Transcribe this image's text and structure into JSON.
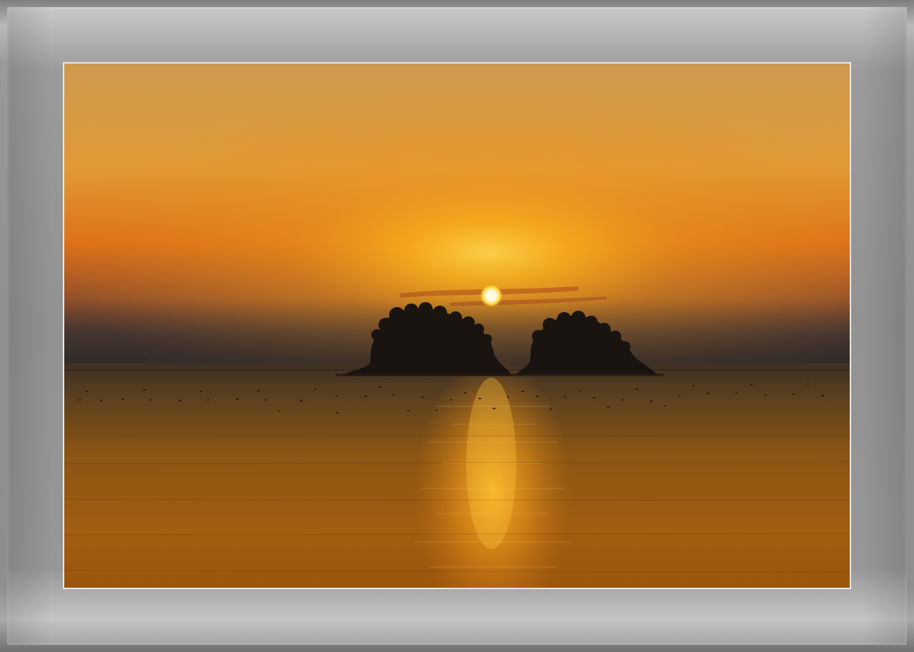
{
  "scene": {
    "subject": "two-islands-sunset-over-sea",
    "colors": {
      "sky_top": "#cf9a4a",
      "sky_glow": "#f5ad1c",
      "sky_mid": "#e07a18",
      "sky_low": "#5a3a2a",
      "horizon_haze": "#3e3230",
      "sun": "#fff4b0",
      "sea_far": "#3a2e22",
      "sea_mid": "#8a5412",
      "sea_near": "#b0630f",
      "reflection": "#f5a623",
      "island": "#1a1410",
      "frame_gray": "#929292"
    }
  }
}
